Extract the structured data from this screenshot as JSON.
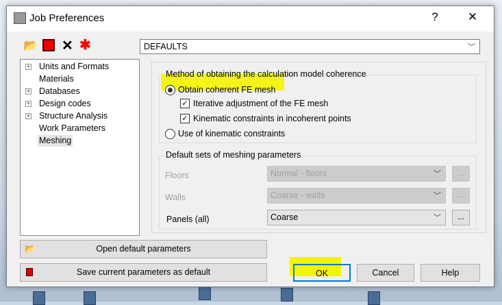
{
  "window": {
    "title": "Job Preferences",
    "help": "?",
    "close": "✕"
  },
  "toolbar": {
    "profile": "DEFAULTS"
  },
  "tree": {
    "items": [
      {
        "label": "Units and Formats",
        "expandable": true
      },
      {
        "label": "Materials",
        "expandable": false
      },
      {
        "label": "Databases",
        "expandable": true
      },
      {
        "label": "Design codes",
        "expandable": true
      },
      {
        "label": "Structure Analysis",
        "expandable": true
      },
      {
        "label": "Work Parameters",
        "expandable": false
      },
      {
        "label": "Meshing",
        "expandable": false,
        "selected": true
      }
    ]
  },
  "method": {
    "legend": "Method of obtaining the calculation model coherence",
    "option1": "Obtain coherent FE mesh",
    "option1_selected": true,
    "check1": "Iterative adjustment of the FE mesh",
    "check1_checked": true,
    "check2": "Kinematic constraints in incoherent points",
    "check2_checked": true,
    "option2": "Use of kinematic constraints"
  },
  "defaults": {
    "legend": "Default sets of meshing parameters",
    "rows": [
      {
        "label": "Floors",
        "value": "Normal - floors",
        "more": "...",
        "enabled": false
      },
      {
        "label": "Walls",
        "value": "Coarse - walls",
        "more": "...",
        "enabled": false
      },
      {
        "label": "Panels (all)",
        "value": "Coarse",
        "more": "...",
        "enabled": true
      }
    ]
  },
  "buttons": {
    "open_default": "Open default parameters",
    "save_default": "Save current parameters as default",
    "ok": "OK",
    "cancel": "Cancel",
    "help": "Help"
  },
  "colors": {
    "highlight": "#f4f400",
    "focus": "#0078d7"
  }
}
